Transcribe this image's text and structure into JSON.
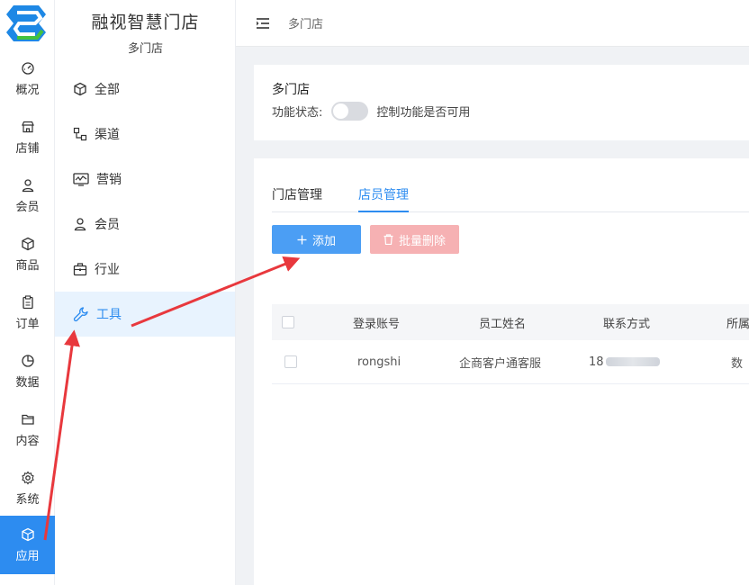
{
  "app": {
    "title": "融视智慧门店",
    "subtitle": "多门店"
  },
  "rail": [
    {
      "label": "概况",
      "icon": "dashboard-icon"
    },
    {
      "label": "店铺",
      "icon": "store-icon"
    },
    {
      "label": "会员",
      "icon": "user-icon"
    },
    {
      "label": "商品",
      "icon": "box-icon"
    },
    {
      "label": "订单",
      "icon": "clipboard-icon"
    },
    {
      "label": "数据",
      "icon": "pie-chart-icon"
    },
    {
      "label": "内容",
      "icon": "folder-icon"
    },
    {
      "label": "系统",
      "icon": "gear-icon"
    },
    {
      "label": "应用",
      "icon": "cube-icon"
    }
  ],
  "submenu": [
    {
      "label": "全部",
      "icon": "cube-icon"
    },
    {
      "label": "渠道",
      "icon": "channel-icon"
    },
    {
      "label": "营销",
      "icon": "monitor-chart-icon"
    },
    {
      "label": "会员",
      "icon": "user-icon"
    },
    {
      "label": "行业",
      "icon": "briefcase-icon"
    },
    {
      "label": "工具",
      "icon": "wrench-icon"
    }
  ],
  "topbar": {
    "breadcrumb": "多门店"
  },
  "feature": {
    "title": "多门店",
    "status_label": "功能状态:",
    "toggle_hint": "控制功能是否可用"
  },
  "tabs": [
    {
      "label": "门店管理"
    },
    {
      "label": "店员管理"
    }
  ],
  "buttons": {
    "add": "添加",
    "batch_delete": "批量删除"
  },
  "table": {
    "headers": [
      "登录账号",
      "员工姓名",
      "联系方式",
      "所属"
    ],
    "rows": [
      {
        "account": "rongshi",
        "name": "企商客户通客服",
        "phone_prefix": "18",
        "store": "数"
      }
    ]
  },
  "colors": {
    "primary": "#2d8cf0",
    "add_button": "#4b9ef4",
    "delete_button": "#f6b1b3",
    "arrow": "#e8383d"
  }
}
